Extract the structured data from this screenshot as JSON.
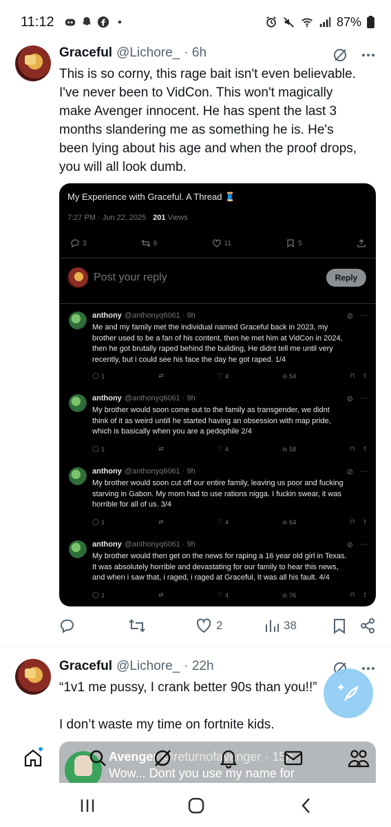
{
  "status_bar": {
    "time": "11:12",
    "battery": "87%"
  },
  "tweet1": {
    "name": "Graceful",
    "handle": "@Lichore_",
    "time": "· 6h",
    "text_lines": [
      "This is so corny, this rage bait isn't even believable.",
      "I've never been to VidCon. This won't magically",
      "make Avenger innocent. He has spent the last 3",
      "months slandering me as something he is. He's",
      "been lying about his age and when the proof drops,",
      "you will all look dumb."
    ],
    "embed": {
      "title": "My Experience with Graceful. A Thread 🧵",
      "meta_time": "7:27 PM · Jun 22, 2025 · ",
      "meta_views_count": "201",
      "meta_views_label": " Views",
      "stats": {
        "replies": "3",
        "reposts": "6",
        "likes": "11",
        "bookmarks": "5"
      },
      "reply_placeholder": "Post your reply",
      "reply_button": "Reply",
      "posts": [
        {
          "name": "anthony",
          "handle": "@anthonyq6061 · 9h",
          "lines": [
            "Me and my family met the individual named Graceful back in 2023, my",
            "brother used to be a fan of his content, then he met him at VidCon in 2024,",
            "then he got brutally raped behind the building, He didnt tell me until very",
            "recently, but i could see his face the day he got raped. 1/4"
          ],
          "replies": "1",
          "likes": "4",
          "views": "54"
        },
        {
          "name": "anthony",
          "handle": "@anthonyq6061 · 9h",
          "lines": [
            "My brother would soon come out to the family as transgender, we didnt",
            "think of it as weird untill he started having an obsession with map pride,",
            "which is basically when you are a pedophile 2/4"
          ],
          "replies": "1",
          "likes": "4",
          "views": "58"
        },
        {
          "name": "anthony",
          "handle": "@anthonyq6061 · 9h",
          "lines": [
            "My brother would soon cut off our entire family, leaving us poor and fucking",
            "starving in Gabon. My mom had to use rations nigga. I fuckin swear, it was",
            "horrible for all of us. 3/4"
          ],
          "replies": "1",
          "likes": "4",
          "views": "64"
        },
        {
          "name": "anthony",
          "handle": "@anthonyq6061 · 9h",
          "lines": [
            "My brother would then get on the news for raping a 16 year old girl in Texas.",
            "It was absolutely horrible and devastating for our family to hear this news,",
            "and when i saw that, i raged, i raged at Graceful, It was all his fault. 4/4"
          ],
          "replies": "1",
          "likes": "4",
          "views": "76"
        }
      ]
    },
    "actions": {
      "likes": "2",
      "views": "38"
    }
  },
  "tweet2": {
    "name": "Graceful",
    "handle": "@Lichore_",
    "time": "· 22h",
    "line1": "“1v1 me pussy, I crank better 90s than you!!”",
    "line2": "I don’t waste my time on fortnite kids."
  },
  "dm_preview": {
    "name": "Avenger",
    "handle": "@returnofavenger · 15h",
    "text": "Wow... Dont you use my name for"
  },
  "colors": {
    "accent": "#1d9bf0",
    "fab": "#8ecdf5",
    "text": "#0f1419",
    "muted": "#536471"
  }
}
